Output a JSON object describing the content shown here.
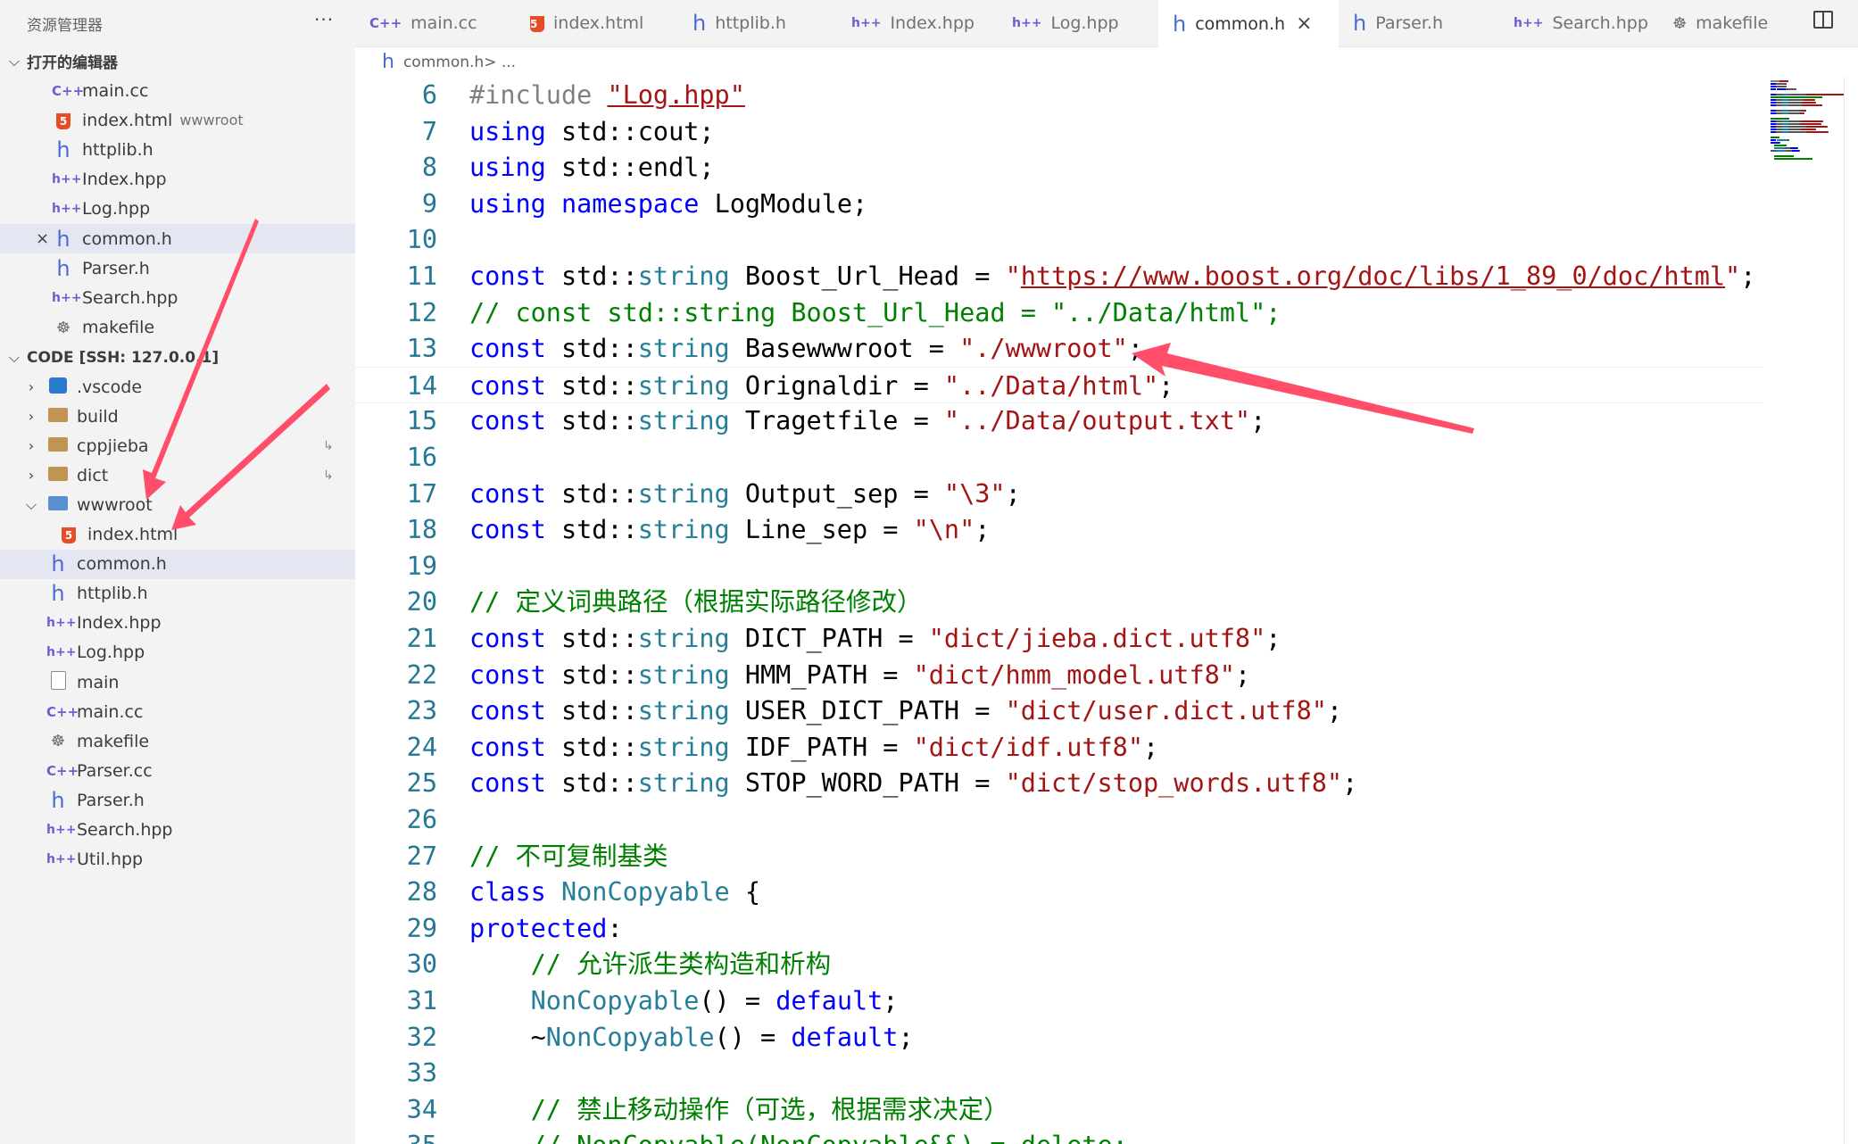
{
  "sidebar": {
    "title": "资源管理器",
    "more": "···",
    "open_editors": {
      "header": "打开的编辑器",
      "items": [
        {
          "name": "main.cc",
          "icon": "c-icon"
        },
        {
          "name": "index.html",
          "icon": "html-icon",
          "desc": "wwwroot"
        },
        {
          "name": "httplib.h",
          "icon": "h-icon"
        },
        {
          "name": "Index.hpp",
          "icon": "hpp-icon"
        },
        {
          "name": "Log.hpp",
          "icon": "hpp-icon"
        },
        {
          "name": "common.h",
          "icon": "h-icon",
          "close": "×"
        },
        {
          "name": "Parser.h",
          "icon": "h-icon"
        },
        {
          "name": "Search.hpp",
          "icon": "hpp-icon"
        },
        {
          "name": "makefile",
          "icon": "gnu-icon"
        }
      ]
    },
    "workspace": {
      "header": "CODE [SSH: 127.0.0.1]",
      "items": [
        {
          "name": ".vscode",
          "icon": "vscode-folder-icon"
        },
        {
          "name": "build",
          "icon": "folder-icon"
        },
        {
          "name": "cppjieba",
          "icon": "folder-icon",
          "link": "↳"
        },
        {
          "name": "dict",
          "icon": "folder-icon",
          "link": "↳"
        },
        {
          "name": "wwwroot",
          "icon": "www-folder-icon"
        },
        {
          "name": "index.html",
          "icon": "html-icon"
        },
        {
          "name": "common.h",
          "icon": "h-icon"
        },
        {
          "name": "httplib.h",
          "icon": "h-icon"
        },
        {
          "name": "Index.hpp",
          "icon": "hpp-icon"
        },
        {
          "name": "Log.hpp",
          "icon": "hpp-icon"
        },
        {
          "name": "main",
          "icon": "file-icon"
        },
        {
          "name": "main.cc",
          "icon": "c-icon"
        },
        {
          "name": "makefile",
          "icon": "gnu-icon"
        },
        {
          "name": "Parser.cc",
          "icon": "c-icon"
        },
        {
          "name": "Parser.h",
          "icon": "h-icon"
        },
        {
          "name": "Search.hpp",
          "icon": "hpp-icon"
        },
        {
          "name": "Util.hpp",
          "icon": "hpp-icon"
        }
      ]
    }
  },
  "tabs": [
    {
      "label": "main.cc",
      "icon": "c-icon"
    },
    {
      "label": "index.html",
      "icon": "html-icon"
    },
    {
      "label": "httplib.h",
      "icon": "h-icon"
    },
    {
      "label": "Index.hpp",
      "icon": "hpp-icon"
    },
    {
      "label": "Log.hpp",
      "icon": "hpp-icon"
    },
    {
      "label": "common.h",
      "icon": "h-icon",
      "active": true,
      "close": "×"
    },
    {
      "label": "Parser.h",
      "icon": "h-icon"
    },
    {
      "label": "Search.hpp",
      "icon": "hpp-icon"
    },
    {
      "label": "makefile",
      "icon": "gnu-icon"
    }
  ],
  "breadcrumb": {
    "file": "common.h",
    "sep": " > ...",
    "icon": "h-icon"
  },
  "icon_glyphs": {
    "c-icon": "C++",
    "h-icon": "h",
    "hpp-icon": "h++",
    "html-icon": "5",
    "gnu-icon": "☸",
    "folder-icon": "",
    "vscode-folder-icon": "",
    "www-folder-icon": "",
    "file-icon": ""
  },
  "colors": {
    "keyword": "#0000ff",
    "type": "#267f99",
    "string": "#a31515",
    "comment": "#008000",
    "line_number": "#237893",
    "arrow": "#ff4d6a"
  },
  "editor": {
    "lines": [
      {
        "n": "6",
        "t": [
          {
            "c": "pp",
            "v": "#include "
          },
          {
            "c": "st ul",
            "v": "\"Log.hpp\""
          }
        ]
      },
      {
        "n": "7",
        "t": [
          {
            "c": "kw",
            "v": "using"
          },
          {
            "v": " std::cout;"
          }
        ]
      },
      {
        "n": "8",
        "t": [
          {
            "c": "kw",
            "v": "using"
          },
          {
            "v": " std::endl;"
          }
        ]
      },
      {
        "n": "9",
        "t": [
          {
            "c": "kw",
            "v": "using"
          },
          {
            "v": " "
          },
          {
            "c": "kw",
            "v": "namespace"
          },
          {
            "v": " LogModule;"
          }
        ]
      },
      {
        "n": "10",
        "t": []
      },
      {
        "n": "11",
        "t": [
          {
            "c": "kw",
            "v": "const"
          },
          {
            "v": " std::"
          },
          {
            "c": "ty",
            "v": "string"
          },
          {
            "v": " Boost_Url_Head = "
          },
          {
            "c": "st",
            "v": "\""
          },
          {
            "c": "st ul",
            "v": "https://www.boost.org/doc/libs/1_89_0/doc/html"
          },
          {
            "c": "st",
            "v": "\""
          },
          {
            "v": ";"
          }
        ]
      },
      {
        "n": "12",
        "t": [
          {
            "c": "cm",
            "v": "// const std::string Boost_Url_Head = \"../Data/html\";"
          }
        ]
      },
      {
        "n": "13",
        "t": [
          {
            "c": "kw",
            "v": "const"
          },
          {
            "v": " std::"
          },
          {
            "c": "ty",
            "v": "string"
          },
          {
            "v": " Basewwwroot = "
          },
          {
            "c": "st",
            "v": "\"./wwwroot\""
          },
          {
            "v": ";"
          }
        ]
      },
      {
        "n": "14",
        "cur": true,
        "t": [
          {
            "c": "kw",
            "v": "const"
          },
          {
            "v": " std::"
          },
          {
            "c": "ty",
            "v": "string"
          },
          {
            "v": " Orignaldir = "
          },
          {
            "c": "st",
            "v": "\"../Data/html\""
          },
          {
            "v": ";"
          }
        ]
      },
      {
        "n": "15",
        "t": [
          {
            "c": "kw",
            "v": "const"
          },
          {
            "v": " std::"
          },
          {
            "c": "ty",
            "v": "string"
          },
          {
            "v": " Tragetfile = "
          },
          {
            "c": "st",
            "v": "\"../Data/output.txt\""
          },
          {
            "v": ";"
          }
        ]
      },
      {
        "n": "16",
        "t": []
      },
      {
        "n": "17",
        "t": [
          {
            "c": "kw",
            "v": "const"
          },
          {
            "v": " std::"
          },
          {
            "c": "ty",
            "v": "string"
          },
          {
            "v": " Output_sep = "
          },
          {
            "c": "st",
            "v": "\"\\3\""
          },
          {
            "v": ";"
          }
        ]
      },
      {
        "n": "18",
        "t": [
          {
            "c": "kw",
            "v": "const"
          },
          {
            "v": " std::"
          },
          {
            "c": "ty",
            "v": "string"
          },
          {
            "v": " Line_sep = "
          },
          {
            "c": "st",
            "v": "\"\\n\""
          },
          {
            "v": ";"
          }
        ]
      },
      {
        "n": "19",
        "t": []
      },
      {
        "n": "20",
        "t": [
          {
            "c": "cm",
            "v": "// 定义词典路径（根据实际路径修改）"
          }
        ]
      },
      {
        "n": "21",
        "t": [
          {
            "c": "kw",
            "v": "const"
          },
          {
            "v": " std::"
          },
          {
            "c": "ty",
            "v": "string"
          },
          {
            "v": " DICT_PATH = "
          },
          {
            "c": "st",
            "v": "\"dict/jieba.dict.utf8\""
          },
          {
            "v": ";"
          }
        ]
      },
      {
        "n": "22",
        "t": [
          {
            "c": "kw",
            "v": "const"
          },
          {
            "v": " std::"
          },
          {
            "c": "ty",
            "v": "string"
          },
          {
            "v": " HMM_PATH = "
          },
          {
            "c": "st",
            "v": "\"dict/hmm_model.utf8\""
          },
          {
            "v": ";"
          }
        ]
      },
      {
        "n": "23",
        "t": [
          {
            "c": "kw",
            "v": "const"
          },
          {
            "v": " std::"
          },
          {
            "c": "ty",
            "v": "string"
          },
          {
            "v": " USER_DICT_PATH = "
          },
          {
            "c": "st",
            "v": "\"dict/user.dict.utf8\""
          },
          {
            "v": ";"
          }
        ]
      },
      {
        "n": "24",
        "t": [
          {
            "c": "kw",
            "v": "const"
          },
          {
            "v": " std::"
          },
          {
            "c": "ty",
            "v": "string"
          },
          {
            "v": " IDF_PATH = "
          },
          {
            "c": "st",
            "v": "\"dict/idf.utf8\""
          },
          {
            "v": ";"
          }
        ]
      },
      {
        "n": "25",
        "t": [
          {
            "c": "kw",
            "v": "const"
          },
          {
            "v": " std::"
          },
          {
            "c": "ty",
            "v": "string"
          },
          {
            "v": " STOP_WORD_PATH = "
          },
          {
            "c": "st",
            "v": "\"dict/stop_words.utf8\""
          },
          {
            "v": ";"
          }
        ]
      },
      {
        "n": "26",
        "t": []
      },
      {
        "n": "27",
        "t": [
          {
            "c": "cm",
            "v": "// 不可复制基类"
          }
        ]
      },
      {
        "n": "28",
        "t": [
          {
            "c": "kw",
            "v": "class"
          },
          {
            "v": " "
          },
          {
            "c": "ty",
            "v": "NonCopyable"
          },
          {
            "v": " {"
          }
        ]
      },
      {
        "n": "29",
        "t": [
          {
            "c": "kw",
            "v": "protected"
          },
          {
            "v": ":"
          }
        ]
      },
      {
        "n": "30",
        "t": [
          {
            "v": "    "
          },
          {
            "c": "cm",
            "v": "// 允许派生类构造和析构"
          }
        ]
      },
      {
        "n": "31",
        "t": [
          {
            "v": "    "
          },
          {
            "c": "ty",
            "v": "NonCopyable"
          },
          {
            "v": "() = "
          },
          {
            "c": "kw",
            "v": "default"
          },
          {
            "v": ";"
          }
        ]
      },
      {
        "n": "32",
        "t": [
          {
            "v": "    ~"
          },
          {
            "c": "ty",
            "v": "NonCopyable"
          },
          {
            "v": "() = "
          },
          {
            "c": "kw",
            "v": "default"
          },
          {
            "v": ";"
          }
        ]
      },
      {
        "n": "33",
        "t": []
      },
      {
        "n": "34",
        "t": [
          {
            "v": "    "
          },
          {
            "c": "cm",
            "v": "// 禁止移动操作（可选，根据需求决定）"
          }
        ]
      },
      {
        "n": "35",
        "t": [
          {
            "v": "    "
          },
          {
            "c": "cm",
            "v": "// NonCopyable(NonCopyable&&) = delete;"
          }
        ]
      }
    ]
  }
}
